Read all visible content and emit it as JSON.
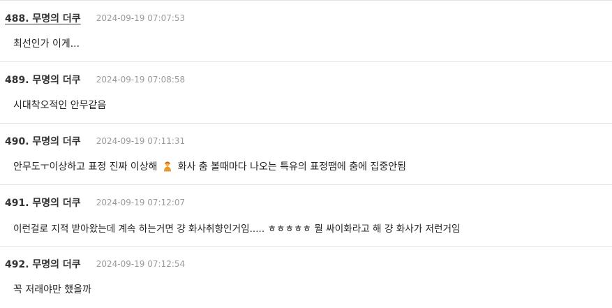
{
  "comments": [
    {
      "author": "488. 무명의 더쿠",
      "timestamp": "2024-09-19 07:07:53",
      "body": "최선인가 이게..."
    },
    {
      "author": "489. 무명의 더쿠",
      "timestamp": "2024-09-19 07:08:58",
      "body": "시대착오적인 안무같음"
    },
    {
      "author": "490. 무명의 더쿠",
      "timestamp": "2024-09-19 07:11:31",
      "body_before_emoji": "안무도ㅜ이상하고 표정 진짜 이상해",
      "emoji": "person-gesturing-icon",
      "body_after_emoji": "화사 춤 볼때마다 나오는 특유의 표정땜에 춤에 집중안됨"
    },
    {
      "author": "491. 무명의 더쿠",
      "timestamp": "2024-09-19 07:12:07",
      "body": "이런걸로 지적 받아왔는데 계속 하는거면 걍 화사취향인거임..... ㅎㅎㅎㅎㅎ 뭘 싸이화라고 해 걍 화사가 저런거임"
    },
    {
      "author": "492. 무명의 더쿠",
      "timestamp": "2024-09-19 07:12:54",
      "body": "꼭 저래야만 했을까"
    }
  ],
  "colors": {
    "divider": "#e2e2e2",
    "author": "#333333",
    "timestamp": "#9a9a9a",
    "body": "#222222",
    "emoji_skin": "#f5b14a",
    "emoji_body": "#e99a2c"
  }
}
